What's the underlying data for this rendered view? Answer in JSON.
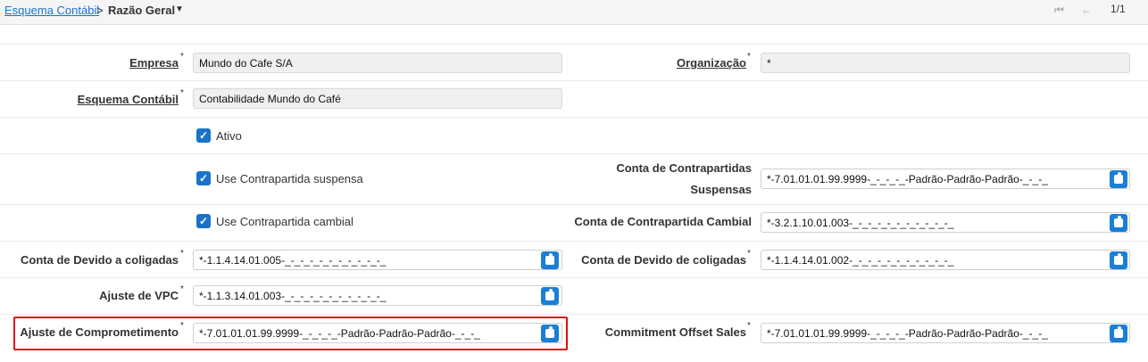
{
  "breadcrumb": {
    "parent": "Esquema Contábil",
    "separator": ">",
    "current": "Razão Geral"
  },
  "pager": {
    "first": "⏮",
    "prev": "←",
    "count": "1/1"
  },
  "form": {
    "empresa": {
      "label": "Empresa",
      "value": "Mundo do Cafe S/A"
    },
    "organizacao": {
      "label": "Organização",
      "value": "*"
    },
    "esquema": {
      "label": "Esquema Contábil",
      "value": "Contabilidade Mundo do Café"
    },
    "ativo": {
      "label": "Ativo",
      "checked": true
    },
    "contrapartida_suspensa": {
      "label": "Use Contrapartida suspensa",
      "checked": true
    },
    "conta_contrapartidas_suspensas": {
      "label_line1": "Conta de Contrapartidas",
      "label_line2": "Suspensas",
      "value": "*-7.01.01.01.99.9999-_-_-_-_-Padrão-Padrão-Padrão-_-_-_"
    },
    "contrapartida_cambial": {
      "label": "Use Contrapartida cambial",
      "checked": true
    },
    "conta_contrapartida_cambial": {
      "label": "Conta de Contrapartida Cambial",
      "value": "*-3.2.1.10.01.003-_-_-_-_-_-_-_-_-_-_-_"
    },
    "conta_devido_a_coligadas": {
      "label": "Conta de Devido a coligadas",
      "value": "*-1.1.4.14.01.005-_-_-_-_-_-_-_-_-_-_-_"
    },
    "conta_devido_de_coligadas": {
      "label": "Conta de Devido de coligadas",
      "value": "*-1.1.4.14.01.002-_-_-_-_-_-_-_-_-_-_-_"
    },
    "ajuste_vpc": {
      "label": "Ajuste de VPC",
      "value": "*-1.1.3.14.01.003-_-_-_-_-_-_-_-_-_-_-_"
    },
    "ajuste_comprometimento": {
      "label": "Ajuste de Comprometimento",
      "value": "*-7.01.01.01.99.9999-_-_-_-_-Padrão-Padrão-Padrão-_-_-_"
    },
    "commitment_offset_sales": {
      "label": "Commitment Offset Sales",
      "value": "*-7.01.01.01.99.9999-_-_-_-_-Padrão-Padrão-Padrão-_-_-_"
    }
  },
  "required_marker": "*",
  "check_glyph": "✓",
  "colors": {
    "accent": "#1a73c9",
    "highlight": "#e01010"
  },
  "icons": {
    "lookup": "puzzle-icon",
    "checkbox": "checkmark-icon"
  }
}
